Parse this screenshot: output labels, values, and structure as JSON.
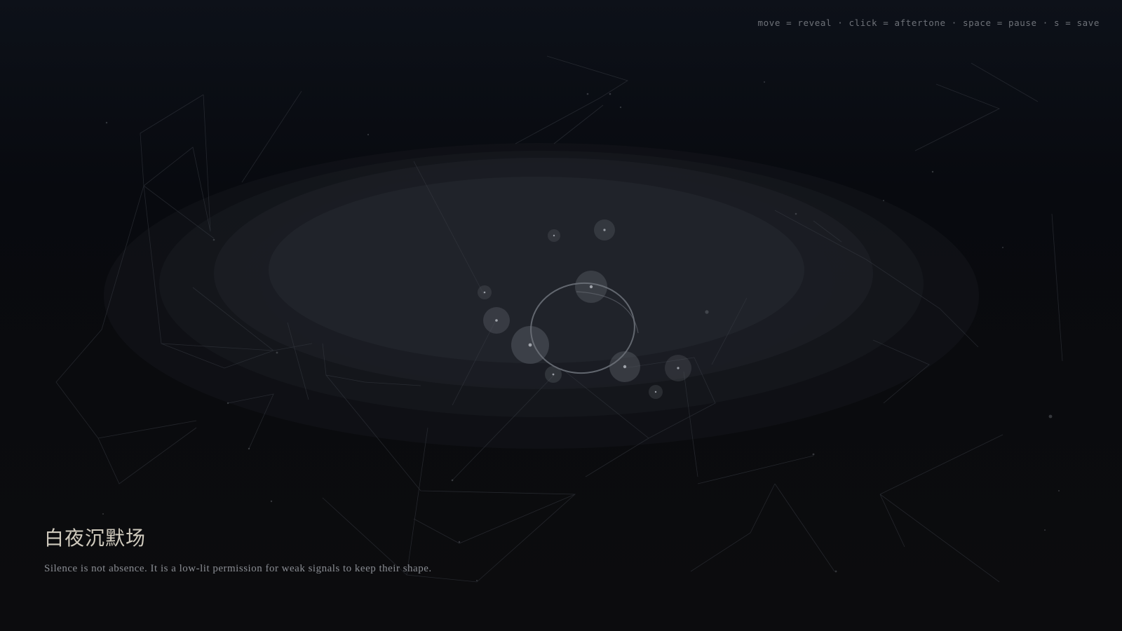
{
  "controls_hint": "move = reveal · click = aftertone · space = pause · s = save",
  "title": "白夜沉默场",
  "subtitle": "Silence is not absence. It is a low-lit permission for weak signals to keep their shape.",
  "colors": {
    "background": "#080a0f",
    "halo": "#1f2229",
    "ring": "#6f737b",
    "node": "#8e939b",
    "title": "#cfcabd",
    "subtitle": "#8a8d93",
    "hint": "#6e7279"
  }
}
